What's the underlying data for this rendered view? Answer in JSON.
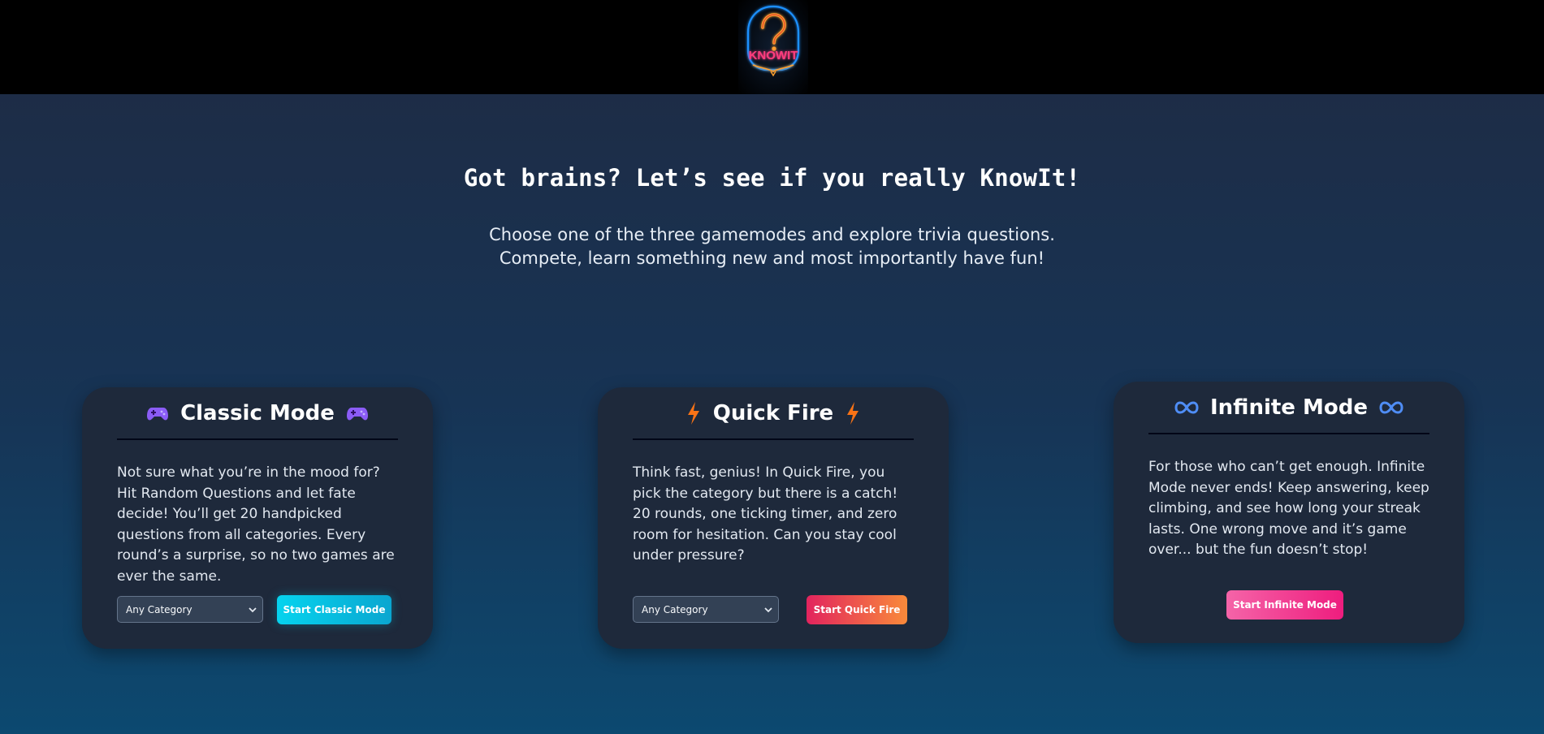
{
  "header": {
    "logo_text": "KNOWIT",
    "logo_icon": "neon-question-mark-icon"
  },
  "hero": {
    "title": "Got brains? Let’s see if you really KnowIt!",
    "subtitle_line1": "Choose one of the three gamemodes and explore trivia questions.",
    "subtitle_line2": "Compete, learn something new and most importantly have fun!"
  },
  "modes": [
    {
      "title": "Classic Mode",
      "icon": "game-controller-icon",
      "description": "Not sure what you’re in the mood for? Hit Random Questions and let fate decide! You’ll get 20 handpicked questions from all categories. Every round’s a surprise, so no two games are ever the same.",
      "select_value": "Any Category",
      "button_label": "Start Classic Mode"
    },
    {
      "title": "Quick Fire",
      "icon": "lightning-bolt-icon",
      "description": "Think fast, genius! In Quick Fire, you pick the category but there is a catch! 20 rounds, one ticking timer, and zero room for hesitation. Can you stay cool under pressure?",
      "select_value": "Any Category",
      "button_label": "Start Quick Fire"
    },
    {
      "title": "Infinite Mode",
      "icon": "infinity-icon",
      "description": "For those who can’t get enough. Infinite Mode never ends! Keep answering, keep climbing, and see how long your streak lasts. One wrong move and it’s game over... but the fun doesn’t stop!",
      "button_label": "Start Infinite Mode"
    }
  ],
  "colors": {
    "classic_button": "#06d3ee",
    "quick_button_start": "#e2245e",
    "quick_button_end": "#f98a3a",
    "infinite_button": "#ee1d7e",
    "card_bg": "#1e293b",
    "logo_pink": "#ff3d7f",
    "logo_orange": "#ffa02e",
    "logo_blue": "#1e90ff"
  }
}
